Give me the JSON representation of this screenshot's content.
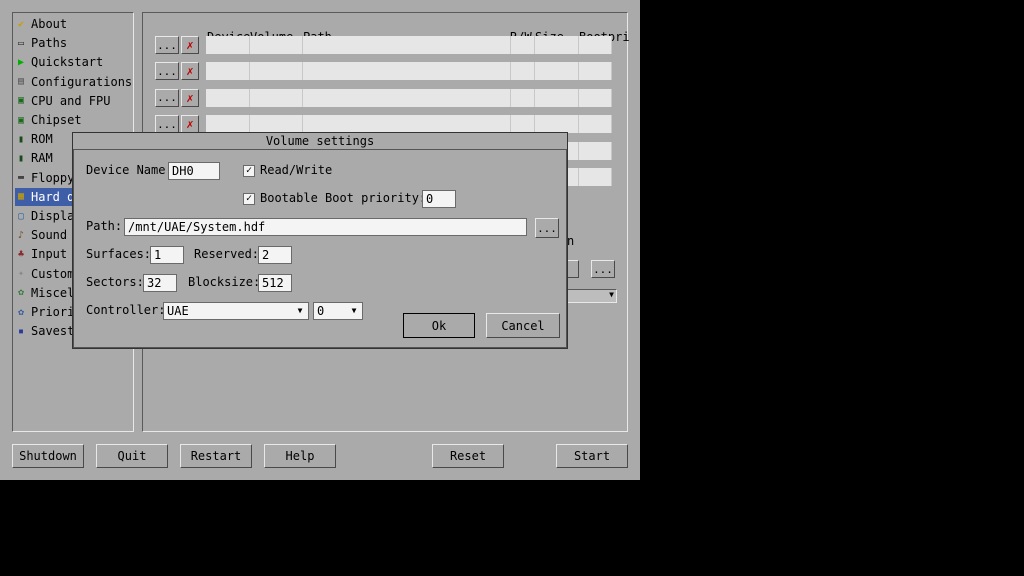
{
  "sidebar": {
    "items": [
      {
        "label": "About",
        "icon": "checkmark-icon",
        "glyph": "✔",
        "color": "#c8a000"
      },
      {
        "label": "Paths",
        "icon": "folder-icon",
        "glyph": "▭",
        "color": "#333333"
      },
      {
        "label": "Quickstart",
        "icon": "play-icon",
        "glyph": "▶",
        "color": "#00b000"
      },
      {
        "label": "Configurations",
        "icon": "document-icon",
        "glyph": "▤",
        "color": "#555555"
      },
      {
        "label": "CPU and FPU",
        "icon": "cpu-icon",
        "glyph": "▣",
        "color": "#1a6a1a"
      },
      {
        "label": "Chipset",
        "icon": "chip-icon",
        "glyph": "▣",
        "color": "#1a6a1a"
      },
      {
        "label": "ROM",
        "icon": "rom-chip-icon",
        "glyph": "▮",
        "color": "#1a4a1a"
      },
      {
        "label": "RAM",
        "icon": "ram-chip-icon",
        "glyph": "▮",
        "color": "#1a4a1a"
      },
      {
        "label": "Floppy",
        "icon": "floppy-drive-icon",
        "glyph": "▬",
        "color": "#444444"
      },
      {
        "label": "Hard d",
        "icon": "hard-drive-icon",
        "glyph": "▦",
        "color": "#c8a000"
      },
      {
        "label": "Displa",
        "icon": "monitor-icon",
        "glyph": "▢",
        "color": "#336699"
      },
      {
        "label": "Sound",
        "icon": "sound-icon",
        "glyph": "♪",
        "color": "#7a4a20"
      },
      {
        "label": "Input",
        "icon": "joystick-icon",
        "glyph": "♣",
        "color": "#8a2a2a"
      },
      {
        "label": "Custom",
        "icon": "gamepad-icon",
        "glyph": "✦",
        "color": "#888888"
      },
      {
        "label": "Miscel",
        "icon": "misc-icon",
        "glyph": "✿",
        "color": "#3a7a3a"
      },
      {
        "label": "Priori",
        "icon": "priority-icon",
        "glyph": "✿",
        "color": "#3a5a9a"
      },
      {
        "label": "Savest",
        "icon": "save-icon",
        "glyph": "▪",
        "color": "#2a3a9a"
      }
    ],
    "selected_index": 9
  },
  "table": {
    "headers": {
      "device": "Device",
      "volume": "Volume",
      "path": "Path",
      "rw": "R/W",
      "size": "Size",
      "bootpri": "Bootpri"
    },
    "row_browse_label": "...",
    "row_delete_label": "✗"
  },
  "dialog": {
    "title": "Volume settings",
    "device_name_label": "Device Name:",
    "device_name_value": "DH0",
    "read_write_label": "Read/Write",
    "read_write_checked": "✓",
    "bootable_label": "Bootable",
    "bootable_checked": "✓",
    "boot_priority_label": "Boot priority:",
    "boot_priority_value": "0",
    "path_label": "Path:",
    "path_value": "/mnt/UAE/System.hdf",
    "path_browse_label": "...",
    "surfaces_label": "Surfaces:",
    "surfaces_value": "1",
    "reserved_label": "Reserved:",
    "reserved_value": "2",
    "sectors_label": "Sectors:",
    "sectors_value": "32",
    "blocksize_label": "Blocksize:",
    "blocksize_value": "512",
    "controller_label": "Controller:",
    "controller_value": "UAE",
    "controller_unit_value": "0",
    "ok_label": "Ok",
    "cancel_label": "Cancel"
  },
  "partial": {
    "right_edge_char": "n",
    "browse_label": "..."
  },
  "bottom": {
    "shutdown": "Shutdown",
    "quit": "Quit",
    "restart": "Restart",
    "help": "Help",
    "reset": "Reset",
    "start": "Start"
  }
}
